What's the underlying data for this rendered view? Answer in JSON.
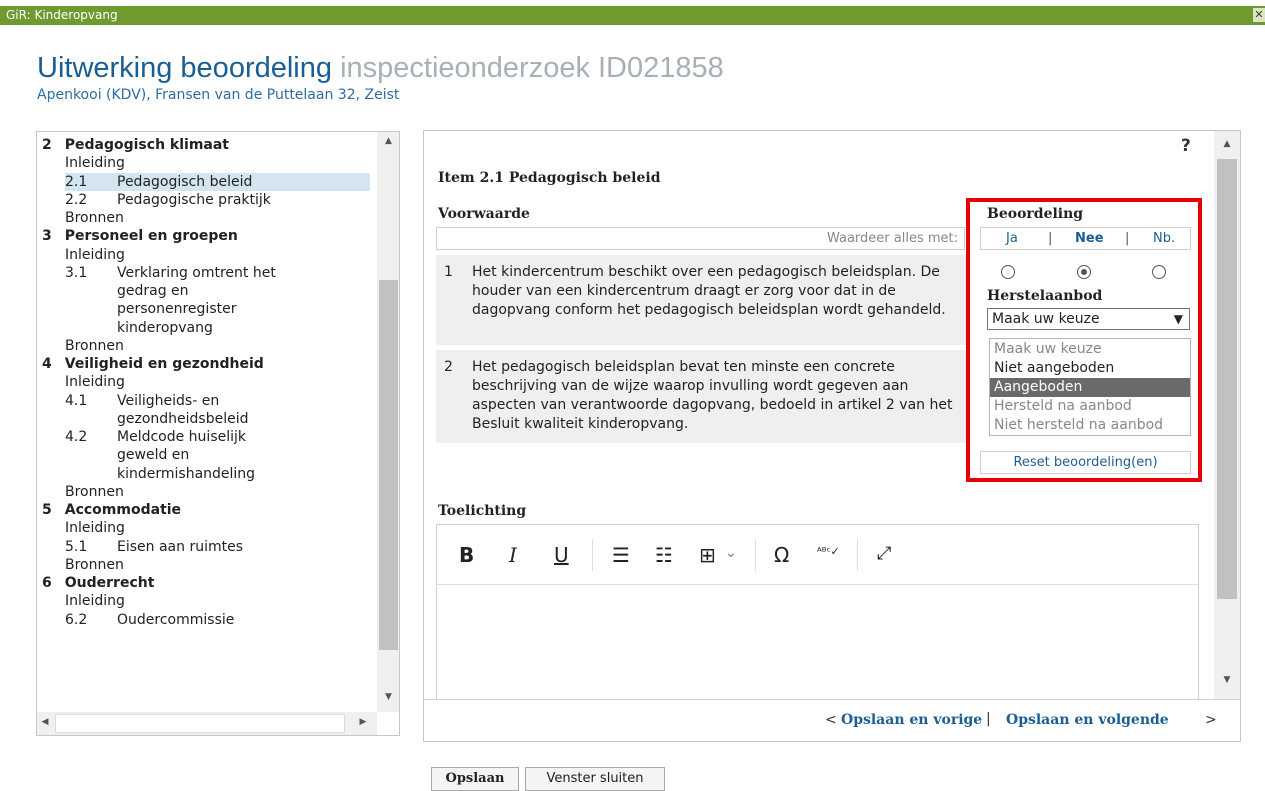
{
  "window": {
    "title": "GiR: Kinderopvang",
    "close_glyph": "✕"
  },
  "header": {
    "title_main": "Uitwerking beoordeling",
    "title_light": "inspectieonderzoek ID021858",
    "subtitle": "Apenkooi (KDV), Fransen van de Puttelaan 32, Zeist"
  },
  "tree": [
    {
      "num": "2",
      "label": "Pedagogisch klimaat",
      "kind": "section"
    },
    {
      "label": "Inleiding",
      "kind": "leaf"
    },
    {
      "num": "2.1",
      "label": "Pedagogisch beleid",
      "kind": "item",
      "selected": true
    },
    {
      "num": "2.2",
      "label": "Pedagogische praktijk",
      "kind": "item"
    },
    {
      "label": "Bronnen",
      "kind": "leaf"
    },
    {
      "num": "3",
      "label": "Personeel en groepen",
      "kind": "section"
    },
    {
      "label": "Inleiding",
      "kind": "leaf"
    },
    {
      "num": "3.1",
      "label": "Verklaring omtrent het",
      "kind": "item"
    },
    {
      "label": "gedrag en",
      "kind": "cont"
    },
    {
      "label": "personenregister",
      "kind": "cont"
    },
    {
      "label": "kinderopvang",
      "kind": "cont"
    },
    {
      "label": "Bronnen",
      "kind": "leaf"
    },
    {
      "num": "4",
      "label": "Veiligheid en gezondheid",
      "kind": "section"
    },
    {
      "label": "Inleiding",
      "kind": "leaf"
    },
    {
      "num": "4.1",
      "label": "Veiligheids- en",
      "kind": "item"
    },
    {
      "label": "gezondheidsbeleid",
      "kind": "cont"
    },
    {
      "num": "4.2",
      "label": "Meldcode huiselijk",
      "kind": "item"
    },
    {
      "label": "geweld en",
      "kind": "cont"
    },
    {
      "label": "kindermishandeling",
      "kind": "cont"
    },
    {
      "label": "Bronnen",
      "kind": "leaf"
    },
    {
      "num": "5",
      "label": "Accommodatie",
      "kind": "section"
    },
    {
      "label": "Inleiding",
      "kind": "leaf"
    },
    {
      "num": "5.1",
      "label": "Eisen aan ruimtes",
      "kind": "item"
    },
    {
      "label": "Bronnen",
      "kind": "leaf"
    },
    {
      "num": "6",
      "label": "Ouderrecht",
      "kind": "section"
    },
    {
      "label": "Inleiding",
      "kind": "leaf"
    },
    {
      "num": "6.2",
      "label": "Oudercommissie",
      "kind": "item"
    }
  ],
  "item": {
    "title": "Item 2.1 Pedagogisch beleid",
    "voorwaarde_label": "Voorwaarde",
    "waardeer_label": "Waardeer alles met:",
    "conditions": [
      {
        "num": "1",
        "text": "Het kindercentrum beschikt over een pedagogisch beleidsplan. De houder van een kindercentrum draagt er zorg voor dat in de dagopvang conform het pedagogisch beleidsplan wordt gehandeld."
      },
      {
        "num": "2",
        "text": "Het pedagogisch beleidsplan bevat ten minste een concrete beschrijving van de wijze waarop invulling wordt gegeven aan aspecten van verantwoorde dagopvang, bedoeld in artikel 2 van het Besluit kwaliteit kinderopvang."
      }
    ],
    "toelichting_label": "Toelichting"
  },
  "beoordeling": {
    "label": "Beoordeling",
    "ja": "Ja",
    "nee": "Nee",
    "nb": "Nb.",
    "sep": "|",
    "selected": "Nee",
    "herstel_label": "Herstelaanbod",
    "herstel_value": "Maak uw keuze",
    "chevron": "▼",
    "options": [
      {
        "label": "Maak uw keuze",
        "state": "muted"
      },
      {
        "label": "Niet aangeboden",
        "state": "normal"
      },
      {
        "label": "Aangeboden",
        "state": "highlight"
      },
      {
        "label": "Hersteld na aanbod",
        "state": "muted"
      },
      {
        "label": "Niet hersteld na aanbod",
        "state": "muted"
      }
    ],
    "reset_label": "Reset beoordeling(en)"
  },
  "toolbar": {
    "bold": "B",
    "italic": "I",
    "underline": "U",
    "bullet_list": "☰",
    "numbered_list": "☷",
    "table": "⊞",
    "table_caret": "⌄",
    "omega": "Ω",
    "spellcheck": "ᴬᴮᶜ✓",
    "fullscreen": "⤢"
  },
  "help": "?",
  "scroll": {
    "up": "▲",
    "down": "▼",
    "left": "◀",
    "right": "▶"
  },
  "nav": {
    "prev_arrow": "<",
    "prev": "Opslaan en vorige",
    "sep": "|",
    "next": "Opslaan en volgende",
    "next_arrow": ">"
  },
  "buttons": {
    "save": "Opslaan",
    "close": "Venster sluiten"
  },
  "colors": {
    "titlebar": "#6e9a2f",
    "accent": "#1a5e95",
    "highlight_frame": "#e8000b"
  }
}
